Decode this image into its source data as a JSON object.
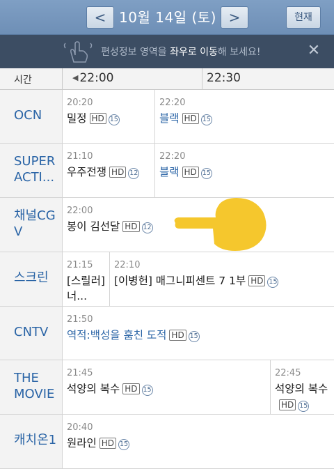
{
  "header": {
    "prev": "<",
    "date": "10월 14일 (토)",
    "next": ">",
    "now": "현재"
  },
  "banner": {
    "pre": "편성정보 영역을 ",
    "bold1": "좌우로 이동",
    "post": "해 보세요!",
    "close": "✕",
    "icon": "swipe-hand-icon"
  },
  "timeline": {
    "label": "시간",
    "slot1": "22:00",
    "slot2": "22:30"
  },
  "channels": [
    {
      "name": "OCN",
      "programs": [
        {
          "time": "20:20",
          "title": "밀정",
          "hd": "HD",
          "rating": "15"
        },
        {
          "time": "22:20",
          "title": "블랙",
          "hd": "HD",
          "rating": "15",
          "blue": true
        }
      ]
    },
    {
      "name": "SUPER ACTI...",
      "programs": [
        {
          "time": "21:10",
          "title": "우주전쟁",
          "hd": "HD",
          "rating": "12"
        },
        {
          "time": "22:20",
          "title": "블랙",
          "hd": "HD",
          "rating": "15",
          "blue": true
        }
      ]
    },
    {
      "name": "채널CGV",
      "programs": [
        {
          "time": "22:00",
          "title": "봉이 김선달",
          "hd": "HD",
          "rating": "12"
        }
      ]
    },
    {
      "name": "스크린",
      "programs": [
        {
          "time": "21:15",
          "title": "[스릴러] 너..."
        },
        {
          "time": "22:10",
          "title": "[이병헌] 매그니피센트 7 1부",
          "hd": "HD",
          "rating": "15"
        }
      ]
    },
    {
      "name": "CNTV",
      "programs": [
        {
          "time": "21:50",
          "title": "역적:백성을 훔친 도적",
          "hd": "HD",
          "rating": "15",
          "blue": true
        }
      ]
    },
    {
      "name": "THE MOVIE",
      "programs": [
        {
          "time": "21:45",
          "title": "석양의 복수",
          "hd": "HD",
          "rating": "15"
        },
        {
          "time": "22:45",
          "title": "석양의 복수",
          "hd": "HD",
          "rating": "15"
        }
      ]
    },
    {
      "name": "캐치온1",
      "programs": [
        {
          "time": "20:40",
          "title": "원라인",
          "hd": "HD",
          "rating": "15"
        }
      ]
    }
  ],
  "overlay": {
    "icon": "pointing-hand-icon",
    "color": "#f5c72d"
  }
}
